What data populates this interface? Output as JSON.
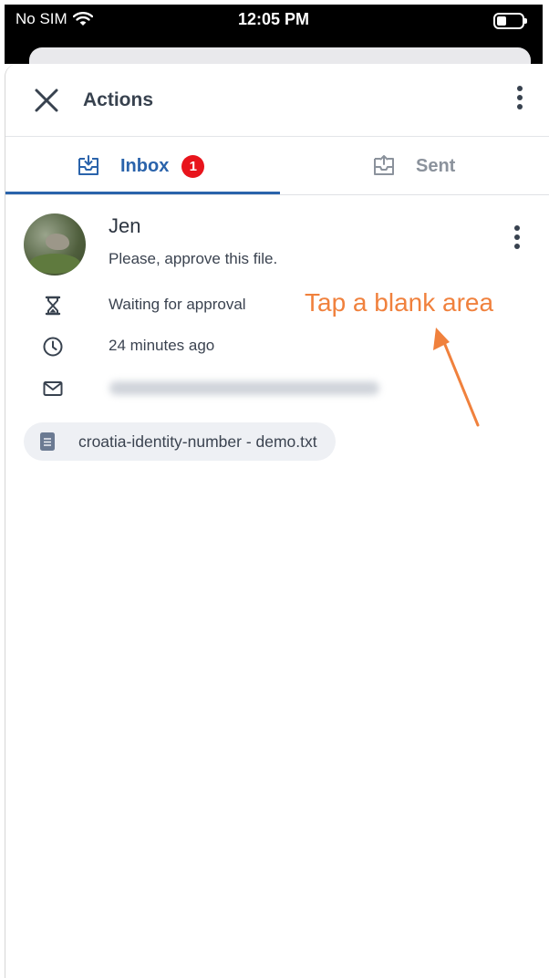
{
  "status_bar": {
    "carrier": "No SIM",
    "time": "12:05 PM"
  },
  "header": {
    "title": "Actions"
  },
  "tabs": [
    {
      "label": "Inbox",
      "badge": "1",
      "active": true
    },
    {
      "label": "Sent",
      "active": false
    }
  ],
  "message": {
    "sender": "Jen",
    "text": "Please, approve this file.",
    "status": "Waiting for approval",
    "time_ago": "24 minutes ago",
    "email": "",
    "file_name": "croatia-identity-number - demo.txt"
  },
  "annotation": {
    "text": "Tap a blank area"
  },
  "colors": {
    "accent": "#2a63ab",
    "badge": "#e8141c",
    "annotation": "#f0813d"
  }
}
